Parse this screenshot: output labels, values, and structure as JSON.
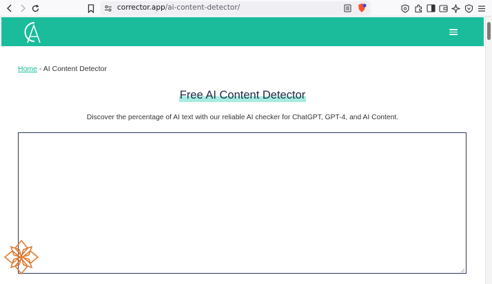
{
  "browser": {
    "url_host": "corrector.app",
    "url_path": "/ai-content-detector/"
  },
  "header": {
    "logo_letters": "CA",
    "brand_color": "#1abc9c"
  },
  "breadcrumb": {
    "home": "Home",
    "separator": " - ",
    "current": "AI Content Detector"
  },
  "main": {
    "title": "Free AI Content Detector",
    "subtitle": "Discover the percentage of AI text with our reliable AI checker for ChatGPT, GPT-4, and AI Content.",
    "input_value": ""
  },
  "icons": {
    "back": "back-arrow-icon",
    "forward": "forward-arrow-icon",
    "reload": "reload-icon",
    "bookmark": "bookmark-icon",
    "site_info": "site-settings-icon",
    "reader": "reader-view-icon",
    "brave": "brave-shield-icon",
    "menu": "hamburger-menu-icon"
  }
}
